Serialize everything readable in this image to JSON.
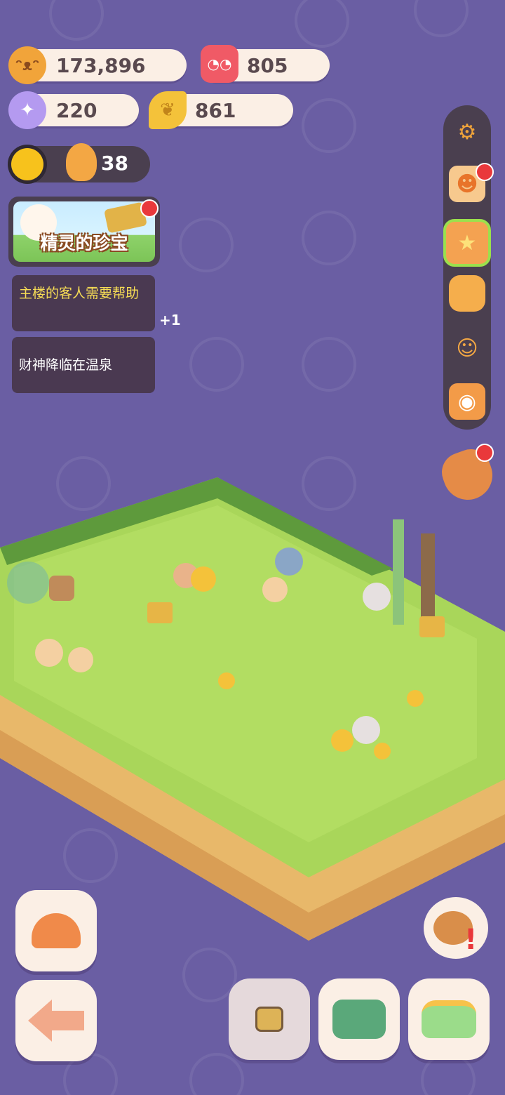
{
  "currencies": [
    {
      "icon": "cookie-coin-icon",
      "value": "173,896"
    },
    {
      "icon": "jelly-candle-icon",
      "value": "805"
    },
    {
      "icon": "crystal-candy-icon",
      "value": "220"
    },
    {
      "icon": "golden-leaf-icon",
      "value": "861"
    }
  ],
  "level": {
    "count": "38"
  },
  "event": {
    "title": "精灵的珍宝"
  },
  "tasks": [
    {
      "text": "主楼的客人需要帮助",
      "color": "#f7dd55"
    },
    {
      "text": "财神降临在温泉",
      "color": "#ffffff"
    }
  ],
  "tasks_more": "+1",
  "side_menu": [
    "settings-gear-icon",
    "stamp-card-icon",
    "star-shop-icon",
    "backpack-icon",
    "friends-icon",
    "camera-icon"
  ],
  "bottom_buttons": [
    "home-mushroom-icon",
    "back-arrow-icon",
    "locked-flower-icon",
    "plant-shop-icon",
    "decor-sofa-icon"
  ],
  "colors": {
    "bg": "#6a5ea3",
    "pill": "#fbefe5",
    "dark": "#4a3f4f",
    "grass": "#a9d65a",
    "accent": "#e9383b"
  }
}
